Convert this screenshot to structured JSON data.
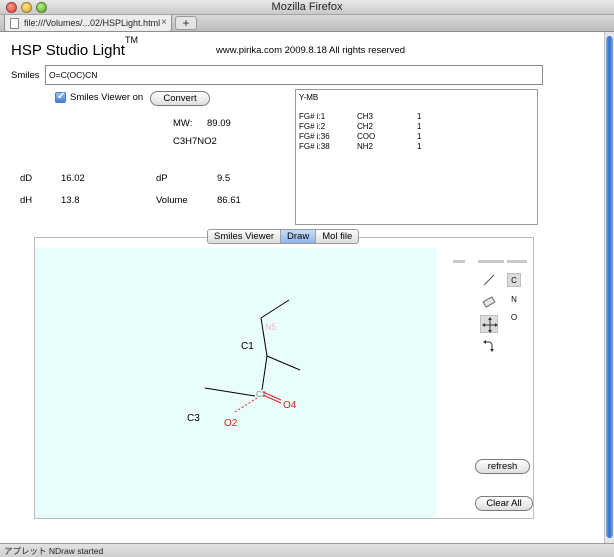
{
  "window": {
    "title": "Mozilla Firefox"
  },
  "tab": {
    "label": "file:///Volumes/...02/HSPLight.html",
    "close": "×",
    "newtab": "+"
  },
  "header": {
    "title": "HSP Studio Light",
    "title_sup": "TM",
    "copyright": "www.pirika.com  2009.8.18  All rights reserved"
  },
  "smiles": {
    "label": "Smiles",
    "value": "O=C(OC)CN",
    "viewer_checkbox_label": "Smiles Viewer on",
    "viewer_checked": true,
    "convert_label": "Convert"
  },
  "mol": {
    "mw_label": "MW:",
    "mw_value": "89.09",
    "formula": "C3H7NO2"
  },
  "hsp": {
    "dD_label": "dD",
    "dD_value": "16.02",
    "dP_label": "dP",
    "dP_value": "9.5",
    "dH_label": "dH",
    "dH_value": "13.8",
    "volume_label": "Volume",
    "volume_value": "86.61"
  },
  "method": "Y-MB",
  "fragments": [
    {
      "id": "FG# i:1",
      "group": "CH3",
      "count": "1"
    },
    {
      "id": "FG# i:2",
      "group": "CH2",
      "count": "1"
    },
    {
      "id": "FG# i:36",
      "group": "COO",
      "count": "1"
    },
    {
      "id": "FG# i:38",
      "group": "NH2",
      "count": "1"
    }
  ],
  "view_tabs": [
    {
      "label": "Smiles Viewer",
      "active": false
    },
    {
      "label": "Draw",
      "active": true
    },
    {
      "label": "Mol file",
      "active": false
    }
  ],
  "molecule_labels": {
    "n5": "N5",
    "c1": "C1",
    "c3": "C3",
    "o4": "O4",
    "o2": "O2",
    "c_left": "C3"
  },
  "tools": {
    "line_icon": "line-icon",
    "eraser_icon": "eraser-icon",
    "move_icon": "move-icon",
    "rotate_icon": "rotate-icon",
    "atoms": [
      "C",
      "N",
      "O"
    ],
    "selected_atom": "C"
  },
  "buttons": {
    "refresh": "refresh",
    "clear_all": "Clear All"
  },
  "status": {
    "text": "アプレット NDraw started"
  },
  "colors": {
    "canvas_bg": "#eafdfd",
    "oxygen": "#e02020",
    "nitrogen_faint": "#f3b8b8",
    "accent_tab": "#8fb5ea"
  }
}
